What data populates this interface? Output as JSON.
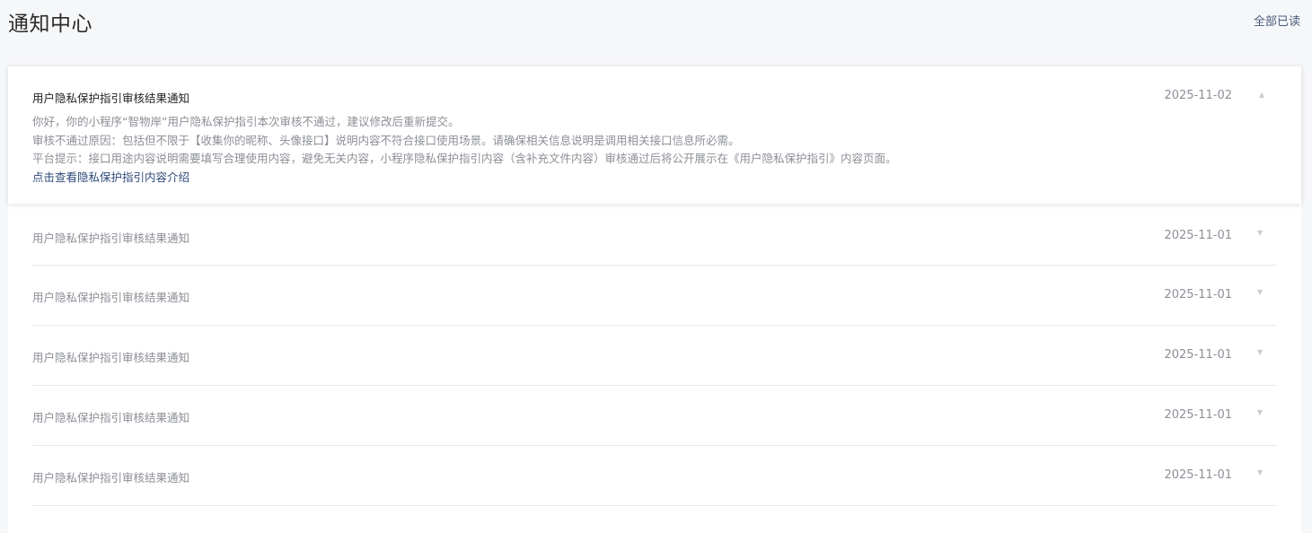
{
  "header": {
    "title": "通知中心",
    "mark_all_read": "全部已读"
  },
  "expanded": {
    "title": "用户隐私保护指引审核结果通知",
    "date": "2025-11-02",
    "lines": [
      "你好，你的小程序“智物岸”用户隐私保护指引本次审核不通过，建议修改后重新提交。",
      "审核不通过原因：包括但不限于【收集你的昵称、头像接口】说明内容不符合接口使用场景。请确保相关信息说明是调用相关接口信息所必需。",
      "平台提示：接口用途内容说明需要填写合理使用内容，避免无关内容，小程序隐私保护指引内容（含补充文件内容）审核通过后将公开展示在《用户隐私保护指引》内容页面。"
    ],
    "link": "点击查看隐私保护指引内容介绍"
  },
  "items": [
    {
      "title": "用户隐私保护指引审核结果通知",
      "date": "2025-11-01"
    },
    {
      "title": "用户隐私保护指引审核结果通知",
      "date": "2025-11-01"
    },
    {
      "title": "用户隐私保护指引审核结果通知",
      "date": "2025-11-01"
    },
    {
      "title": "用户隐私保护指引审核结果通知",
      "date": "2025-11-01"
    },
    {
      "title": "用户隐私保护指引审核结果通知",
      "date": "2025-11-01"
    }
  ],
  "icons": {
    "chevron": "chevron-down-icon"
  }
}
